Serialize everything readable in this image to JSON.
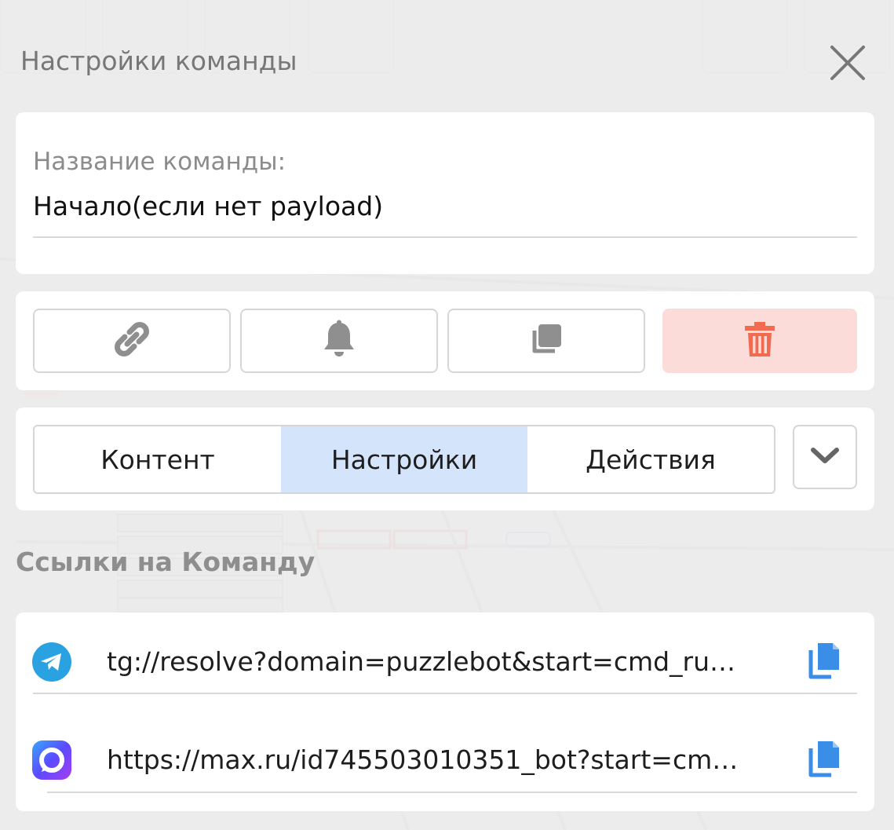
{
  "dialog": {
    "title": "Настройки команды",
    "close_icon": "close-icon"
  },
  "command_name": {
    "label": "Название команды:",
    "value": "Начало(если нет payload)"
  },
  "action_buttons": [
    {
      "name": "link",
      "icon": "link-icon"
    },
    {
      "name": "notification",
      "icon": "bell-icon"
    },
    {
      "name": "duplicate",
      "icon": "copy-icon"
    },
    {
      "name": "delete",
      "icon": "trash-icon"
    }
  ],
  "tabs": [
    {
      "label": "Контент",
      "active": false
    },
    {
      "label": "Настройки",
      "active": true
    },
    {
      "label": "Действия",
      "active": false
    }
  ],
  "links_section": {
    "title": "Ссылки на Команду",
    "links": [
      {
        "platform_icon": "telegram-icon",
        "url": "tg://resolve?domain=puzzlebot&start=cmd_ru…",
        "copy_icon": "copy-icon"
      },
      {
        "platform_icon": "max-icon",
        "url": "https://max.ru/id745503010351_bot?start=cm…",
        "copy_icon": "copy-icon"
      }
    ]
  },
  "colors": {
    "active_tab": "#d3e4fb",
    "danger_bg": "#fbdcd8",
    "danger_icon": "#f26a50",
    "telegram": "#2aa1e0",
    "copy_icon": "#3b8ee8"
  }
}
